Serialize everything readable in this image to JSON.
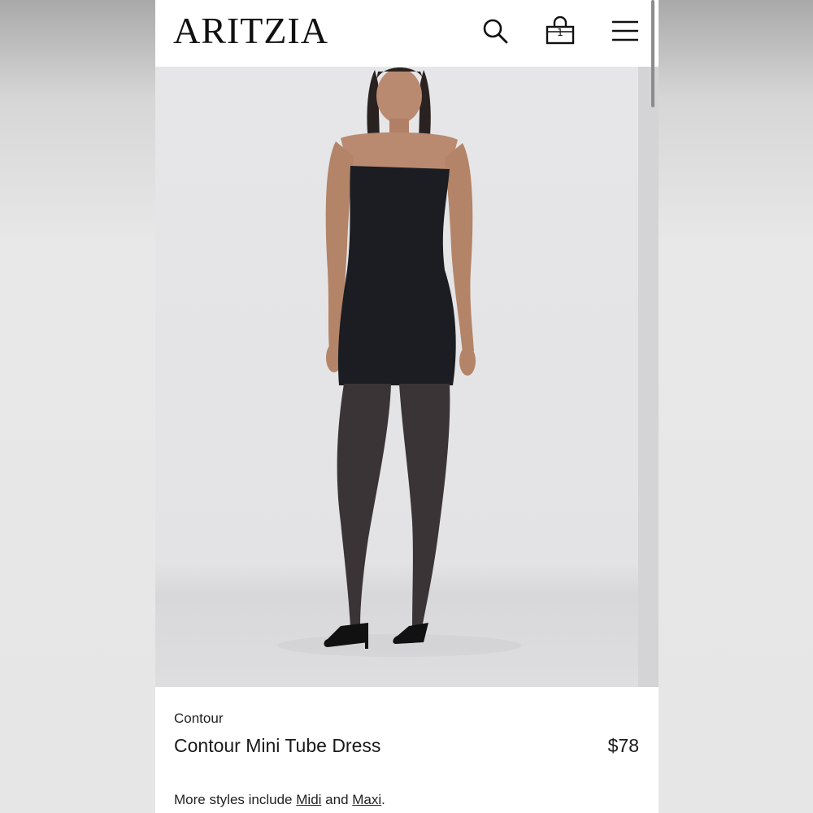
{
  "header": {
    "logo": "ARITZIA",
    "bag_count": "1",
    "icons": [
      "search-icon",
      "shopping-bag-icon",
      "hamburger-menu-icon"
    ]
  },
  "product": {
    "brand": "Contour",
    "name": "Contour Mini Tube Dress",
    "price": "$78",
    "more_styles": {
      "prefix": "More styles include",
      "link1": "Midi",
      "joiner": "and",
      "link2": "Maxi",
      "suffix": "."
    }
  },
  "colors": {
    "background": "#ffffff",
    "text": "#1a1a1a",
    "photo_bg": "#e4e4e6",
    "dress": "#1b1d22"
  }
}
